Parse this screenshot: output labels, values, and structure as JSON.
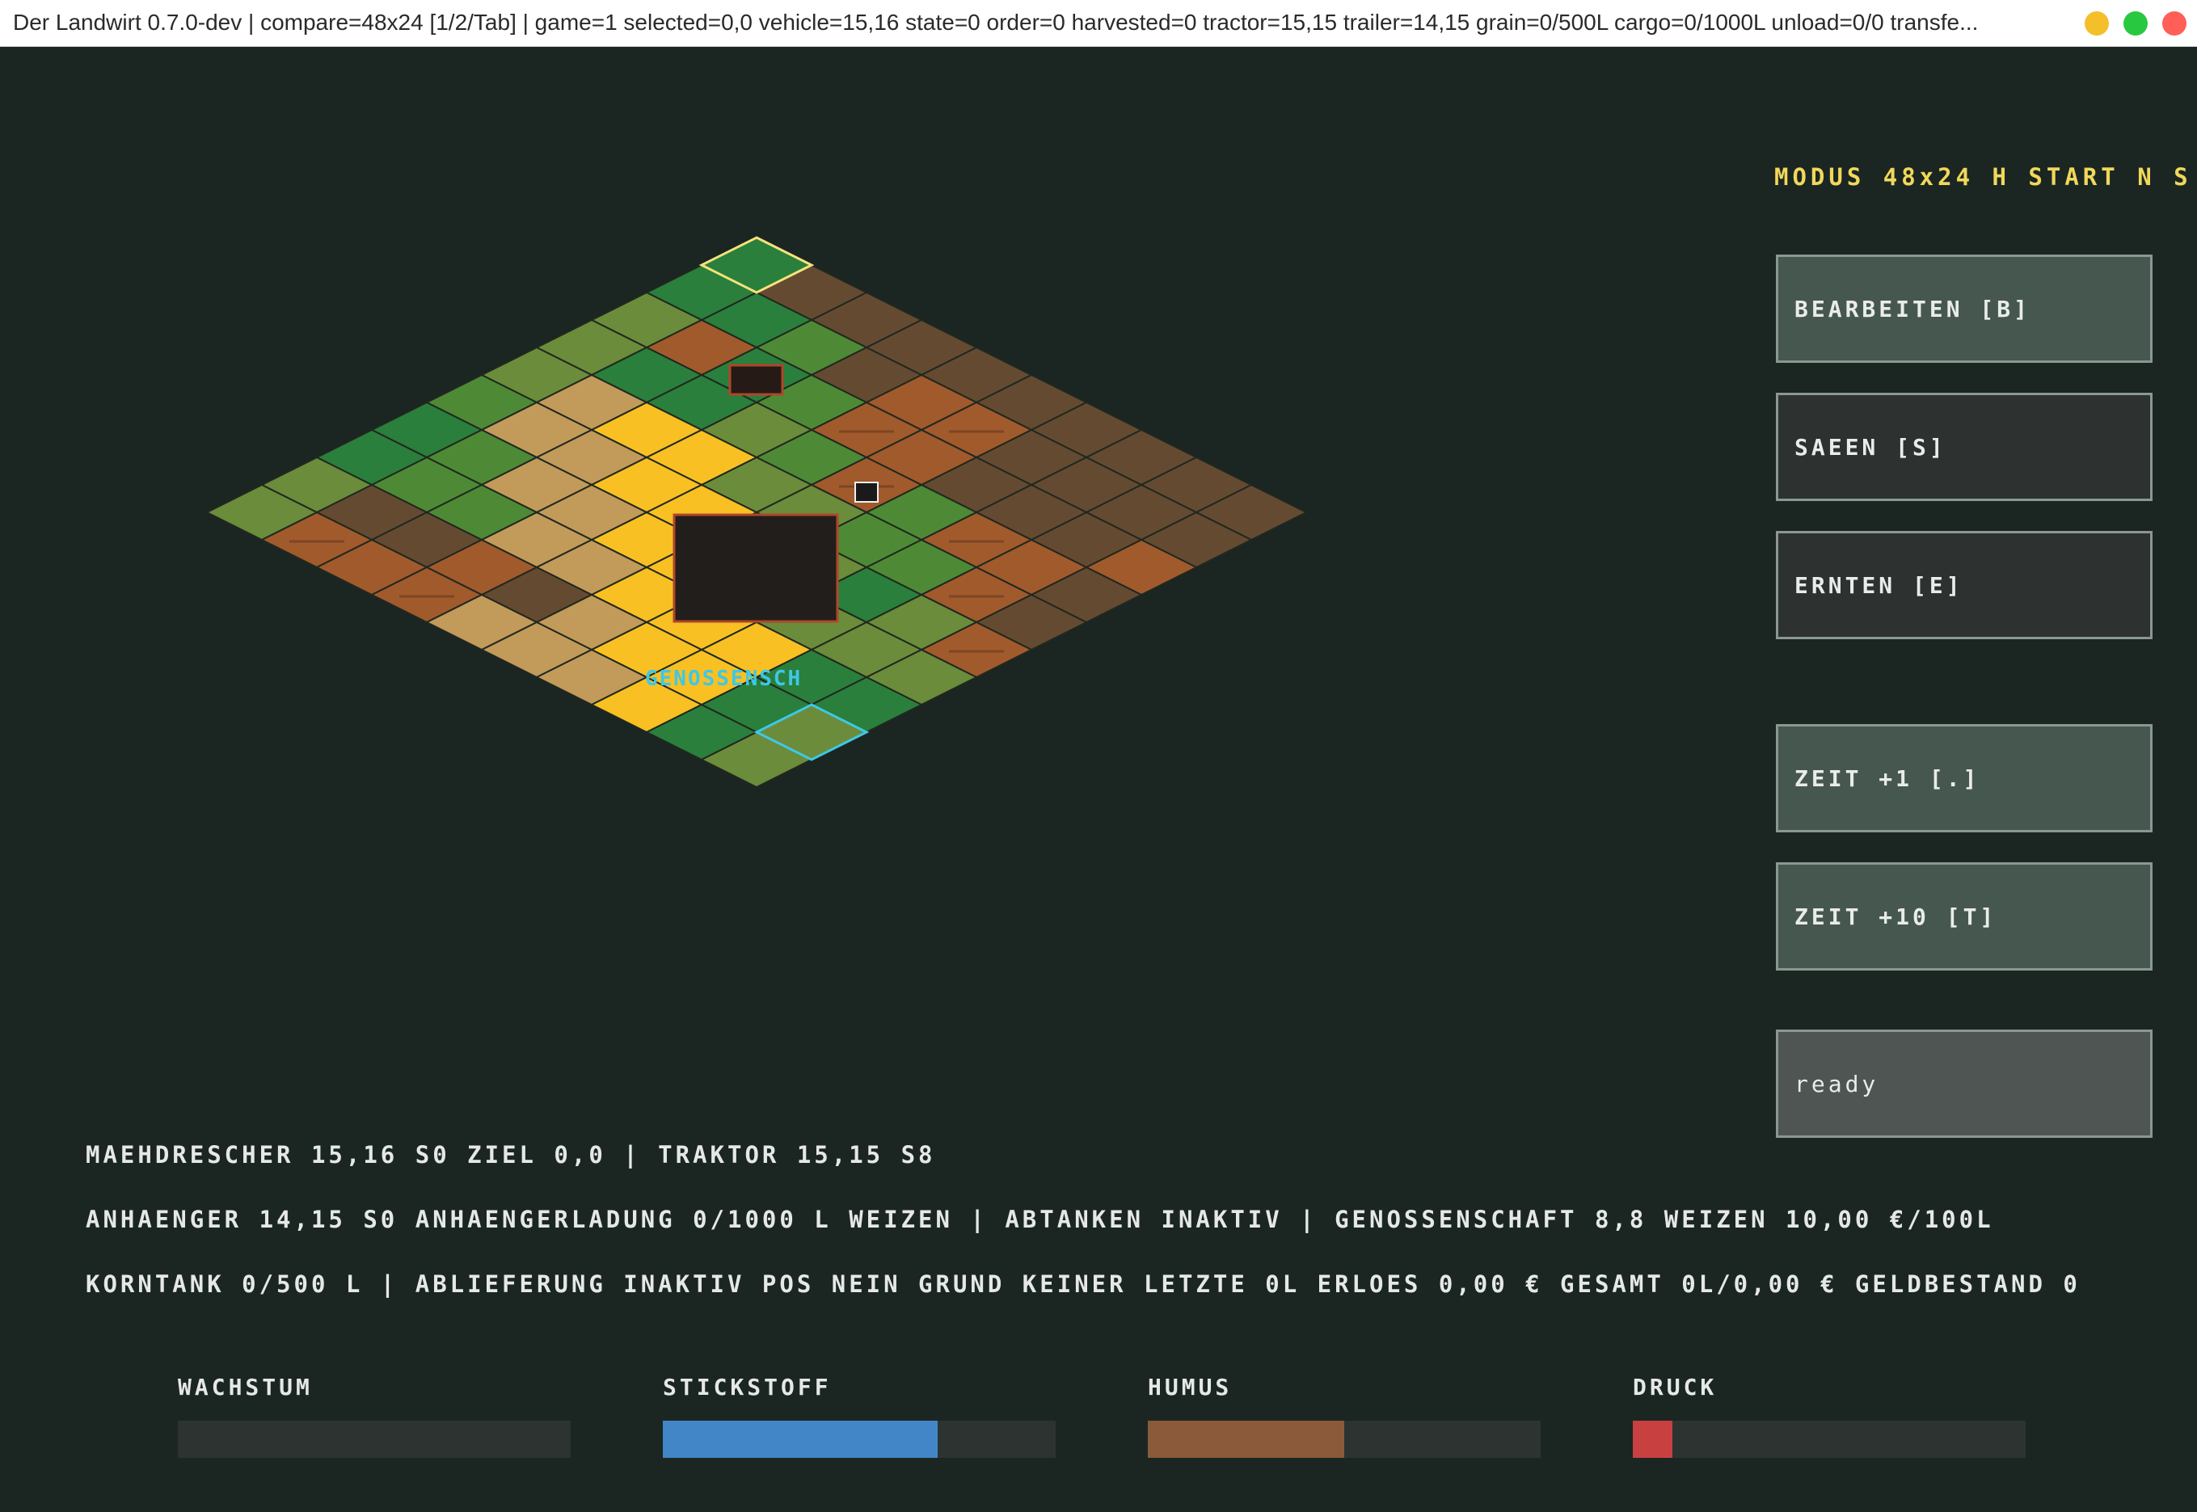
{
  "window": {
    "title": "Der Landwirt 0.7.0-dev | compare=48x24 [1/2/Tab] | game=1 selected=0,0 vehicle=15,16 state=0 order=0 harvested=0 tractor=15,15 trailer=14,15 grain=0/500L cargo=0/1000L unload=0/0 transfe..."
  },
  "game": {
    "modus_line": "MODUS 48x24 H START N S",
    "depot_label": "GENOSSENSCH",
    "map_tiles": [
      [
        "G",
        "d",
        "d",
        "d",
        "d",
        "d",
        "d",
        "d",
        "d",
        "d"
      ],
      [
        "G",
        "G",
        "O",
        "d",
        "b",
        "b",
        "d",
        "d",
        "d",
        "d"
      ],
      [
        "g",
        "b",
        "G",
        "O",
        "b",
        "b",
        "d",
        "d",
        "d",
        "b"
      ],
      [
        "g",
        "G",
        "G",
        "g",
        "O",
        "b",
        "O",
        "b",
        "b",
        "d"
      ],
      [
        "g",
        "t",
        "Y",
        "Y",
        "g",
        "g",
        "O",
        "O",
        "b",
        "d"
      ],
      [
        "O",
        "t",
        "t",
        "Y",
        "Y",
        "g",
        "g",
        "G",
        "g",
        "b"
      ],
      [
        "G",
        "O",
        "t",
        "t",
        "Y",
        "Y",
        "d",
        "g",
        "g",
        "g"
      ],
      [
        "G",
        "O",
        "O",
        "t",
        "t",
        "Y",
        "Y",
        "Y",
        "G",
        "G"
      ],
      [
        "g",
        "d",
        "d",
        "b",
        "d",
        "t",
        "Y",
        "Y",
        "G",
        "g"
      ],
      [
        "g",
        "b",
        "b",
        "b",
        "t",
        "t",
        "t",
        "Y",
        "G",
        "g"
      ]
    ],
    "tile_colors": {
      "G": "#2a7f3c",
      "g": "#6b8c3a",
      "O": "#4e8a36",
      "b": "#a15a2c",
      "d": "#654a32",
      "t": "#c29a5a",
      "Y": "#f8c022"
    }
  },
  "sidebar": {
    "edit_label": "BEARBEITEN [B]",
    "sow_label": "SAEEN [S]",
    "harvest_label": "ERNTEN [E]",
    "time1_label": "ZEIT +1 [.]",
    "time10_label": "ZEIT +10 [T]",
    "status_label": "ready"
  },
  "status": {
    "line1": "MAEHDRESCHER 15,16 S0 ZIEL 0,0 | TRAKTOR 15,15 S8",
    "line2": "ANHAENGER 14,15 S0 ANHAENGERLADUNG 0/1000 L WEIZEN | ABTANKEN INAKTIV | GENOSSENSCHAFT 8,8 WEIZEN 10,00 €/100L",
    "line3": "KORNTANK 0/500 L | ABLIEFERUNG INAKTIV POS NEIN GRUND KEINER LETZTE 0L ERLOES 0,00 € GESAMT 0L/0,00 € GELDBESTAND 0"
  },
  "meters": {
    "growth": {
      "label": "WACHSTUM",
      "value": 0,
      "color": "#4a9e4a"
    },
    "nitrogen": {
      "label": "STICKSTOFF",
      "value": 70,
      "color": "#4286c8"
    },
    "humus": {
      "label": "HUMUS",
      "value": 50,
      "color": "#8a5a3a"
    },
    "pressure": {
      "label": "DRUCK",
      "value": 10,
      "color": "#c94040"
    }
  }
}
